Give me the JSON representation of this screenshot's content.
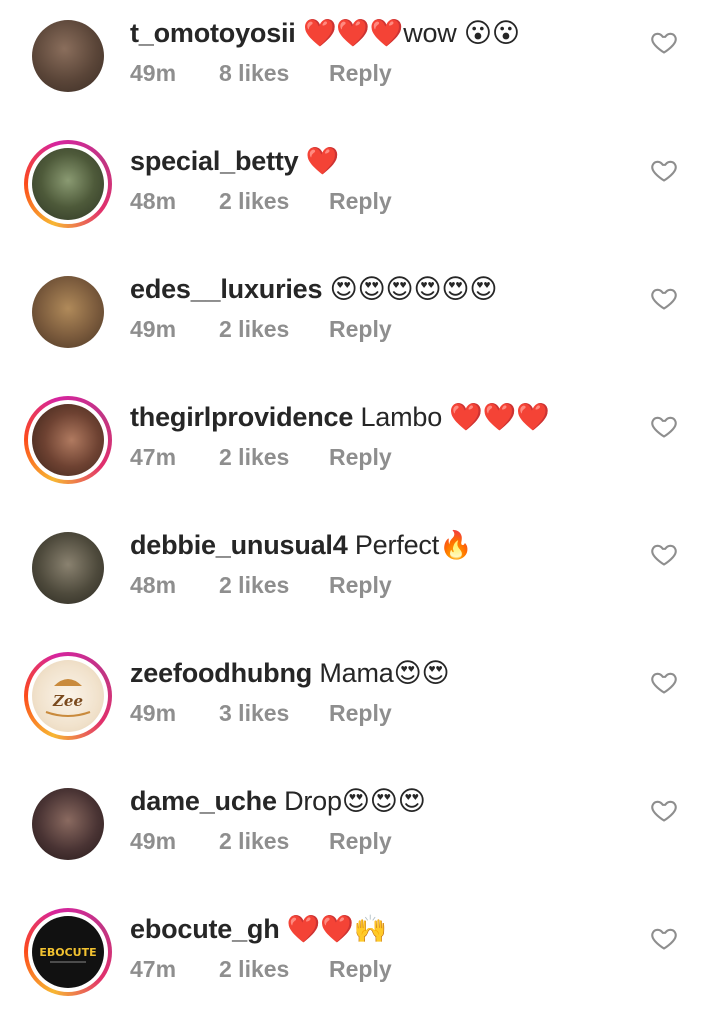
{
  "comments": [
    {
      "username": "t_omotoyosii",
      "text": "❤️❤️❤️wow 😮😮",
      "time": "49m",
      "likes": "8 likes",
      "reply": "Reply",
      "story_ring": false,
      "avatar_color": "#6b5a4e"
    },
    {
      "username": "special_betty",
      "text": "❤️",
      "time": "48m",
      "likes": "2 likes",
      "reply": "Reply",
      "story_ring": true,
      "avatar_color": "#4a5a3a"
    },
    {
      "username": "edes__luxuries",
      "text": "😍😍😍😍😍😍",
      "time": "49m",
      "likes": "2 likes",
      "reply": "Reply",
      "story_ring": false,
      "avatar_color": "#7a5a3c"
    },
    {
      "username": "thegirlprovidence",
      "text": "Lambo ❤️❤️❤️",
      "time": "47m",
      "likes": "2 likes",
      "reply": "Reply",
      "story_ring": true,
      "avatar_color": "#5a3a2e"
    },
    {
      "username": "debbie_unusual4",
      "text": "Perfect🔥",
      "time": "48m",
      "likes": "2 likes",
      "reply": "Reply",
      "story_ring": false,
      "avatar_color": "#4e4a3c"
    },
    {
      "username": "zeefoodhubng",
      "text": "Mama😍😍",
      "time": "49m",
      "likes": "3 likes",
      "reply": "Reply",
      "story_ring": true,
      "avatar_color": "#f4e9dc"
    },
    {
      "username": "dame_uche",
      "text": "Drop😍😍😍",
      "time": "49m",
      "likes": "2 likes",
      "reply": "Reply",
      "story_ring": false,
      "avatar_color": "#3c2e2e"
    },
    {
      "username": "ebocute_gh",
      "text": "❤️❤️🙌",
      "time": "47m",
      "likes": "2 likes",
      "reply": "Reply",
      "story_ring": true,
      "avatar_color": "#111111"
    }
  ],
  "icons": {
    "like": "heart-outline-icon"
  },
  "colors": {
    "meta_gray": "#8e8e8e",
    "text": "#262626"
  }
}
